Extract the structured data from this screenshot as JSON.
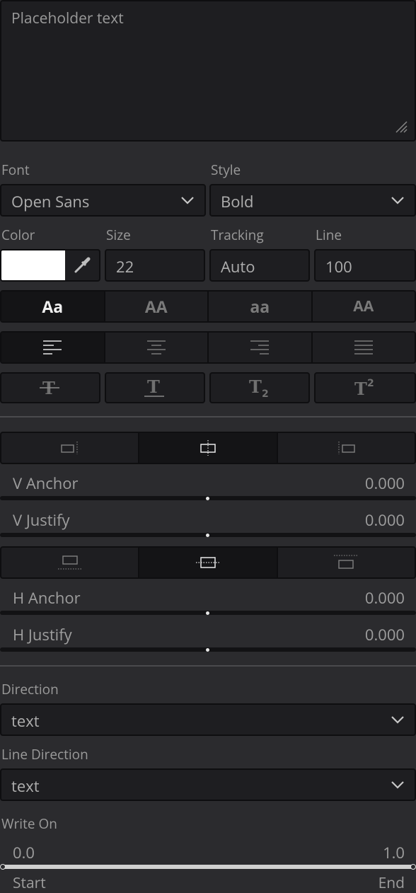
{
  "textarea": {
    "placeholder": "Placeholder text"
  },
  "font": {
    "label": "Font",
    "value": "Open Sans"
  },
  "style": {
    "label": "Style",
    "value": "Bold"
  },
  "color": {
    "label": "Color",
    "swatch": "#ffffff"
  },
  "size": {
    "label": "Size",
    "value": "22"
  },
  "tracking": {
    "label": "Tracking",
    "value": "Auto"
  },
  "line": {
    "label": "Line",
    "value": "100"
  },
  "case_buttons": [
    "Aa",
    "AA",
    "aa",
    "AA"
  ],
  "v_anchor": {
    "label": "V Anchor",
    "value": "0.000"
  },
  "v_justify": {
    "label": "V Justify",
    "value": "0.000"
  },
  "h_anchor": {
    "label": "H Anchor",
    "value": "0.000"
  },
  "h_justify": {
    "label": "H Justify",
    "value": "0.000"
  },
  "direction": {
    "label": "Direction",
    "value": "text"
  },
  "line_direction": {
    "label": "Line Direction",
    "value": "text"
  },
  "write_on": {
    "label": "Write On",
    "start_value": "0.0",
    "end_value": "1.0",
    "start_label": "Start",
    "end_label": "End"
  }
}
